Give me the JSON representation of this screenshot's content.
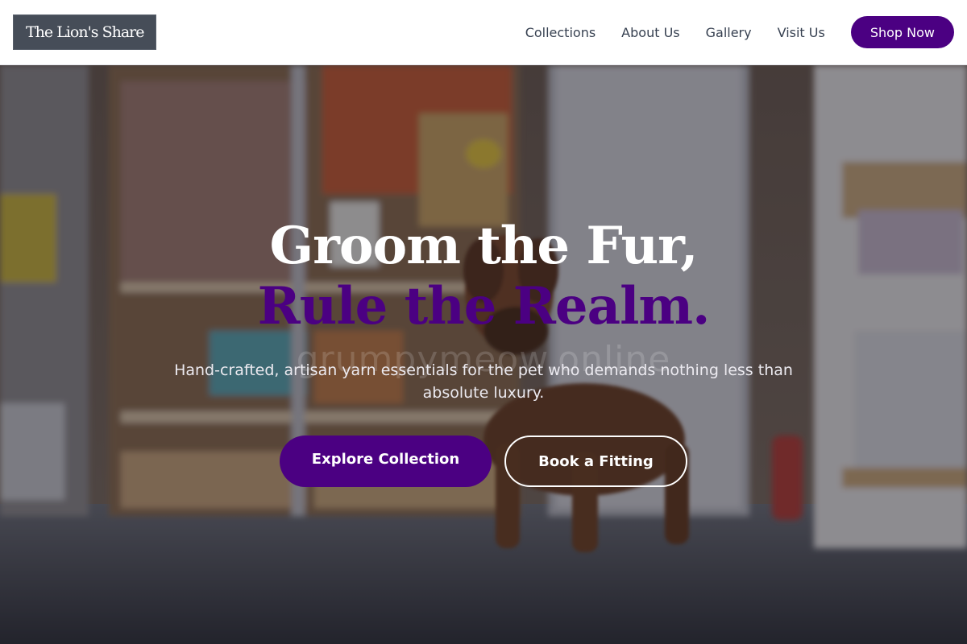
{
  "header": {
    "logo": "The Lion's Share",
    "nav": [
      {
        "label": "Collections"
      },
      {
        "label": "About Us"
      },
      {
        "label": "Gallery"
      },
      {
        "label": "Visit Us"
      }
    ],
    "cta_label": "Shop Now"
  },
  "hero": {
    "headline_line1": "Groom the Fur,",
    "headline_line2": "Rule the Realm.",
    "watermark": "grumpymeow.online",
    "subtitle": "Hand-crafted, artisan yarn essentials for the pet who demands nothing less than absolute luxury.",
    "primary_button": "Explore Collection",
    "secondary_button": "Book a Fitting"
  },
  "colors": {
    "brand": "#4b0082",
    "logo_bg": "#464d58",
    "nav_text": "#374151"
  }
}
